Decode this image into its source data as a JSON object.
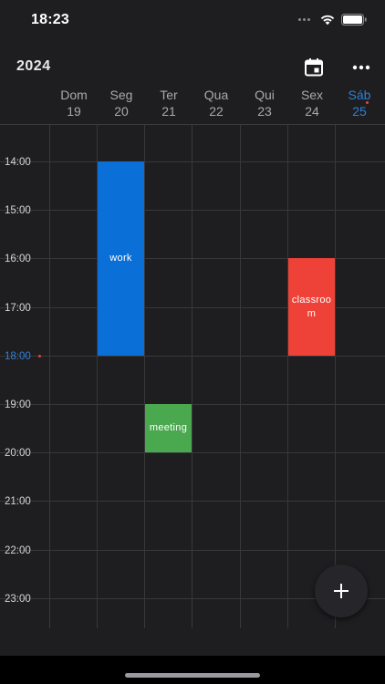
{
  "status_bar": {
    "time": "18:23",
    "icons": [
      "signal-dots-icon",
      "wifi-icon",
      "battery-icon"
    ]
  },
  "header": {
    "year": "2024",
    "calendar_icon": "calendar-icon",
    "more_icon": "more-horizontal-icon"
  },
  "days": [
    {
      "name": "Dom",
      "num": "19",
      "today": false
    },
    {
      "name": "Seg",
      "num": "20",
      "today": false
    },
    {
      "name": "Ter",
      "num": "21",
      "today": false
    },
    {
      "name": "Qua",
      "num": "22",
      "today": false
    },
    {
      "name": "Qui",
      "num": "23",
      "today": false
    },
    {
      "name": "Sex",
      "num": "24",
      "today": false
    },
    {
      "name": "Sáb",
      "num": "25",
      "today": true
    }
  ],
  "hours": [
    "14:00",
    "15:00",
    "16:00",
    "17:00",
    "18:00",
    "19:00",
    "20:00",
    "21:00",
    "22:00",
    "23:00"
  ],
  "current_hour": "18:00",
  "events": [
    {
      "title": "work",
      "day_index": 1,
      "start": "14:00",
      "end": "18:00",
      "color": "#0a6fd6"
    },
    {
      "title": "meeting",
      "day_index": 2,
      "start": "19:00",
      "end": "20:00",
      "color": "#4aa84e"
    },
    {
      "title": "classroom",
      "day_index": 5,
      "start": "16:00",
      "end": "18:00",
      "color": "#ee4238"
    }
  ],
  "fab": {
    "icon": "plus-icon"
  },
  "colors": {
    "background": "#1e1e20",
    "today_accent": "#2f7fd6",
    "today_dot": "#e0443a",
    "gridline": "#38383b"
  }
}
